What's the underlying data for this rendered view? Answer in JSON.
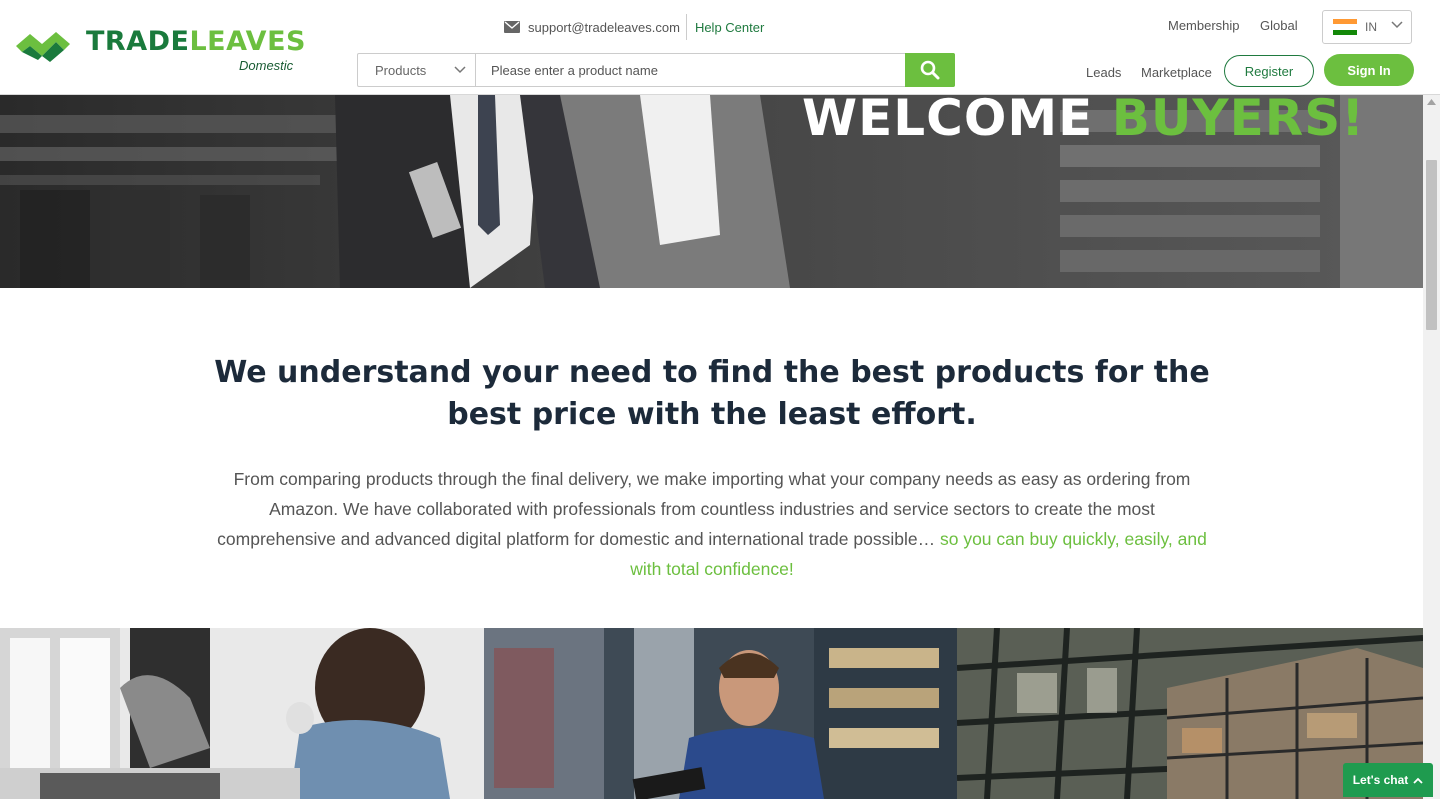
{
  "brand": {
    "name_part1": "TRADE",
    "name_part2": "LEAVES",
    "subtitle": "Domestic",
    "colors": {
      "dark_green": "#1a7a3c",
      "light_green": "#6cbf3f",
      "navy": "#1c2a3a"
    }
  },
  "header": {
    "email": "support@tradeleaves.com",
    "help_center": "Help Center",
    "membership": "Membership",
    "global": "Global",
    "country_code": "IN",
    "leads": "Leads",
    "marketplace": "Marketplace",
    "register": "Register",
    "sign_in": "Sign In"
  },
  "search": {
    "category": "Products",
    "placeholder": "Please enter a product name",
    "button_icon": "search-icon"
  },
  "hero": {
    "title_white": "WELCOME",
    "title_green": "BUYERS!"
  },
  "intro": {
    "heading": "We understand your need to find the best products for the best price with the least effort.",
    "body": "From comparing products through the final delivery, we make importing what your company needs as easy as ordering from Amazon. We have collaborated with professionals from countless industries and service sectors to create the most comprehensive and advanced digital platform for domestic and international trade possible…",
    "accent": "so you can buy quickly, easily, and with total confidence!"
  },
  "chat": {
    "label": "Let's chat",
    "icon": "chevron-up-icon"
  }
}
